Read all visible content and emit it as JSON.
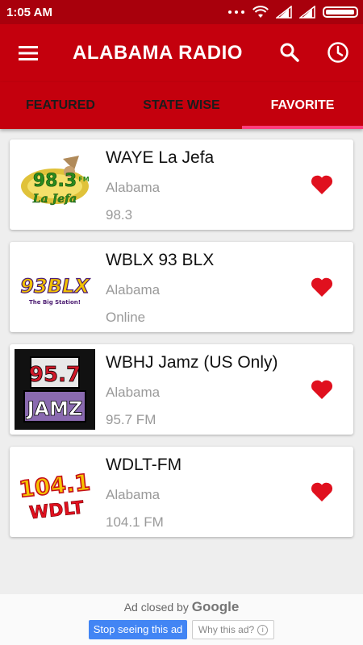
{
  "status_bar": {
    "time": "1:05 AM"
  },
  "app": {
    "title": "ALABAMA RADIO"
  },
  "tabs": [
    {
      "label": "FEATURED"
    },
    {
      "label": "STATE WISE"
    },
    {
      "label": "FAVORITE"
    }
  ],
  "stations": [
    {
      "name": "WAYE La Jefa",
      "state": "Alabama",
      "frequency": "98.3",
      "logo": {
        "line1": "98.3",
        "line2": "La Jefa",
        "small": "FM"
      }
    },
    {
      "name": "WBLX 93 BLX",
      "state": "Alabama",
      "frequency": "Online",
      "logo": {
        "line1": "93BLX",
        "line2": "The Big Station!"
      }
    },
    {
      "name": "WBHJ Jamz (US Only)",
      "state": "Alabama",
      "frequency": "95.7 FM",
      "logo": {
        "line1": "95.7",
        "line2": "JAMZ"
      }
    },
    {
      "name": "WDLT-FM",
      "state": "Alabama",
      "frequency": "104.1 FM",
      "logo": {
        "line1": "104.1",
        "line2": "WDLT"
      }
    }
  ],
  "ad": {
    "closed_prefix": "Ad closed by",
    "brand": "Google",
    "stop_label": "Stop seeing this ad",
    "why_label": "Why this ad?",
    "info_glyph": "i"
  },
  "colors": {
    "primary": "#c4000d",
    "status_bar": "#a8000c",
    "tab_indicator": "#ff3d7b",
    "heart": "#e0101e"
  },
  "icons": [
    "menu-icon",
    "search-icon",
    "history-clock-icon",
    "wifi-icon",
    "signal-icon",
    "battery-icon",
    "heart-icon"
  ]
}
